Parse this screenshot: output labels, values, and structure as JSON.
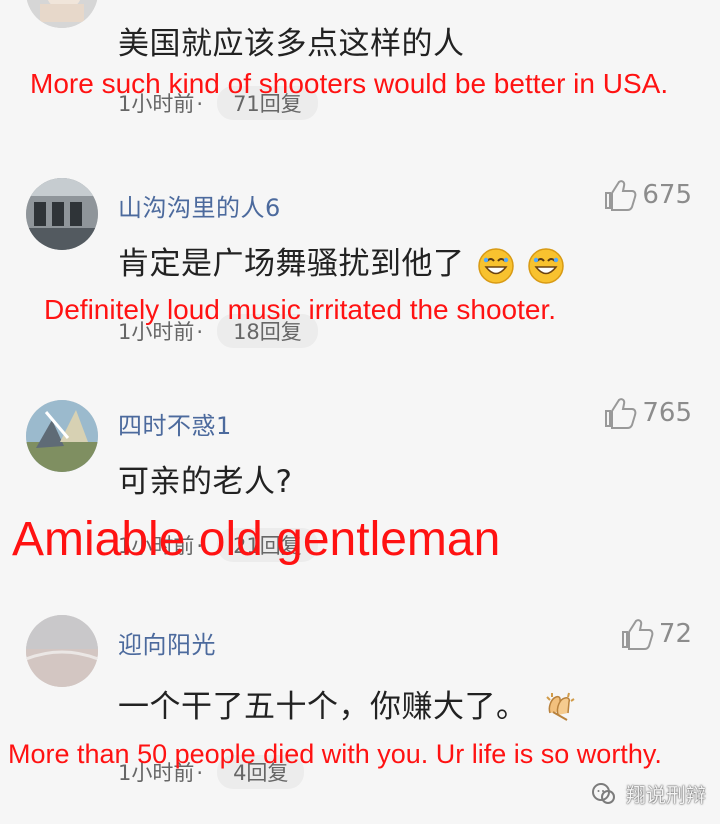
{
  "comments": [
    {
      "id": "comment-1",
      "avatar": "partial-avatar",
      "username": "",
      "likes": "",
      "text": "美国就应该多点这样的人",
      "translation": "More such kind of shooters would be better in USA.",
      "time": "1小时前",
      "replies": "71回复"
    },
    {
      "id": "comment-2",
      "avatar": "seats-avatar",
      "username": "山沟沟里的人6",
      "likes": "675",
      "text": "肯定是广场舞骚扰到他了",
      "translation": "Definitely loud music irritated the shooter.",
      "time": "1小时前",
      "replies": "18回复"
    },
    {
      "id": "comment-3",
      "avatar": "outdoor-avatar",
      "username": "四时不惑1",
      "likes": "765",
      "text": "可亲的老人?",
      "translation": "Amiable old gentleman",
      "time": "1小时前",
      "replies": "21回复"
    },
    {
      "id": "comment-4",
      "avatar": "sunrise-avatar",
      "username": "迎向阳光",
      "likes": "72",
      "text": "一个干了五十个，你赚大了。",
      "translation": "More than 50 people died with you. Ur life is so worthy.",
      "time": "1小时前",
      "replies": "4回复"
    }
  ],
  "watermark": {
    "label": "翔说刑辩"
  },
  "colors": {
    "translation": "#ff1212",
    "username": "#4c6a9d",
    "background": "#f6f6f6"
  }
}
